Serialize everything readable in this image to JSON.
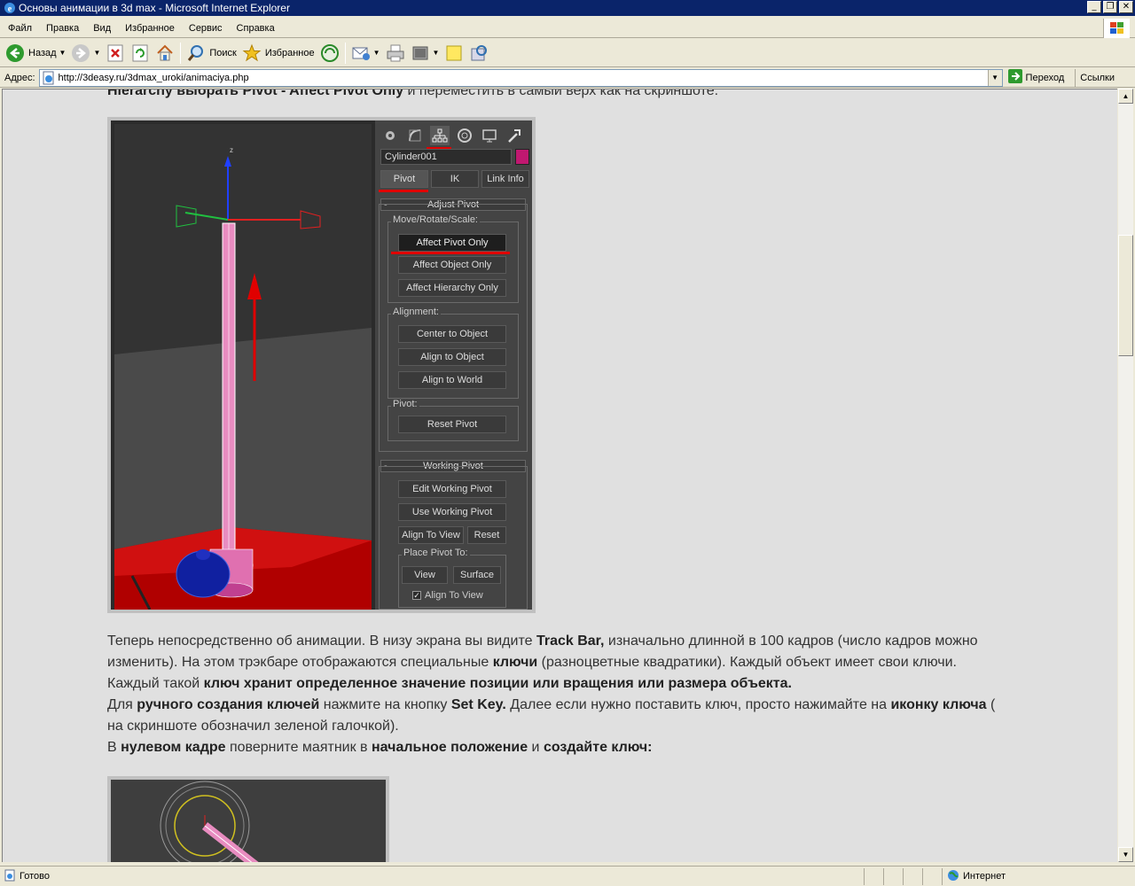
{
  "window": {
    "title": "Основы анимации в 3d max - Microsoft Internet Explorer",
    "controls": [
      "_",
      "❐",
      "✕"
    ]
  },
  "menu": [
    "Файл",
    "Правка",
    "Вид",
    "Избранное",
    "Сервис",
    "Справка"
  ],
  "toolbar": {
    "back": "Назад",
    "search": "Поиск",
    "favorites": "Избранное"
  },
  "address": {
    "label": "Адрес:",
    "url": "http://3deasy.ru/3dmax_uroki/animaciya.php",
    "go": "Переход",
    "links": "Ссылки"
  },
  "content": {
    "intro_bold": "Hierarchy выбрать Pivot - Affect Pivot Only",
    "intro_rest": " и переместить в самый верх как на скриншоте:",
    "para": [
      {
        "t": "Теперь непосредственно об анимации. В низу экрана вы видите ",
        "b": false
      },
      {
        "t": "Track Bar,",
        "b": true
      },
      {
        "t": " изначально длинной в 100 кадров (число кадров можно изменить). На этом трэкбаре отображаются специальные ",
        "b": false
      },
      {
        "t": "ключи",
        "b": true
      },
      {
        "t": " (разноцветные квадратики). Каждый объект имеет свои ключи. Каждый такой ",
        "b": false
      },
      {
        "t": "ключ хранит определенное значение позиции или вращения или размера объекта.",
        "b": true
      }
    ],
    "para2": [
      {
        "t": "Для ",
        "b": false
      },
      {
        "t": "ручного создания ключей",
        "b": true
      },
      {
        "t": " нажмите на кнопку ",
        "b": false
      },
      {
        "t": "Set Key.",
        "b": true
      },
      {
        "t": " Далее если нужно поставить ключ, просто нажимайте на ",
        "b": false
      },
      {
        "t": "иконку ключа",
        "b": true
      },
      {
        "t": " ( на скриншоте обозначил зеленой галочкой).",
        "b": false
      }
    ],
    "para3": [
      {
        "t": "В ",
        "b": false
      },
      {
        "t": "нулевом кадре",
        "b": true
      },
      {
        "t": " поверните маятник в ",
        "b": false
      },
      {
        "t": "начальное положение",
        "b": true
      },
      {
        "t": " и ",
        "b": false
      },
      {
        "t": "создайте ключ:",
        "b": true
      }
    ]
  },
  "max_panel": {
    "object_name": "Cylinder001",
    "swatch_color": "#c01870",
    "tabs": [
      "Pivot",
      "IK",
      "Link Info"
    ],
    "adjust_pivot": {
      "header": "Adjust Pivot",
      "move_group": "Move/Rotate/Scale:",
      "move_buttons": [
        "Affect Pivot Only",
        "Affect Object Only",
        "Affect Hierarchy Only"
      ],
      "align_group": "Alignment:",
      "align_buttons": [
        "Center to Object",
        "Align to Object",
        "Align to World"
      ],
      "pivot_group": "Pivot:",
      "reset": "Reset Pivot"
    },
    "working_pivot": {
      "header": "Working Pivot",
      "edit": "Edit Working Pivot",
      "use": "Use Working Pivot",
      "align_view": "Align To View",
      "reset": "Reset",
      "place_group": "Place Pivot To:",
      "view": "View",
      "surface": "Surface",
      "align_to_view_check": "Align To View"
    },
    "collapse_mark": "-",
    "axis_label": "z"
  },
  "status": {
    "text": "Готово",
    "zone": "Интернет"
  },
  "colors": {
    "titlebar": "#0a246a",
    "highlight_red": "#e00000",
    "content_bg": "#e0e0e0"
  }
}
